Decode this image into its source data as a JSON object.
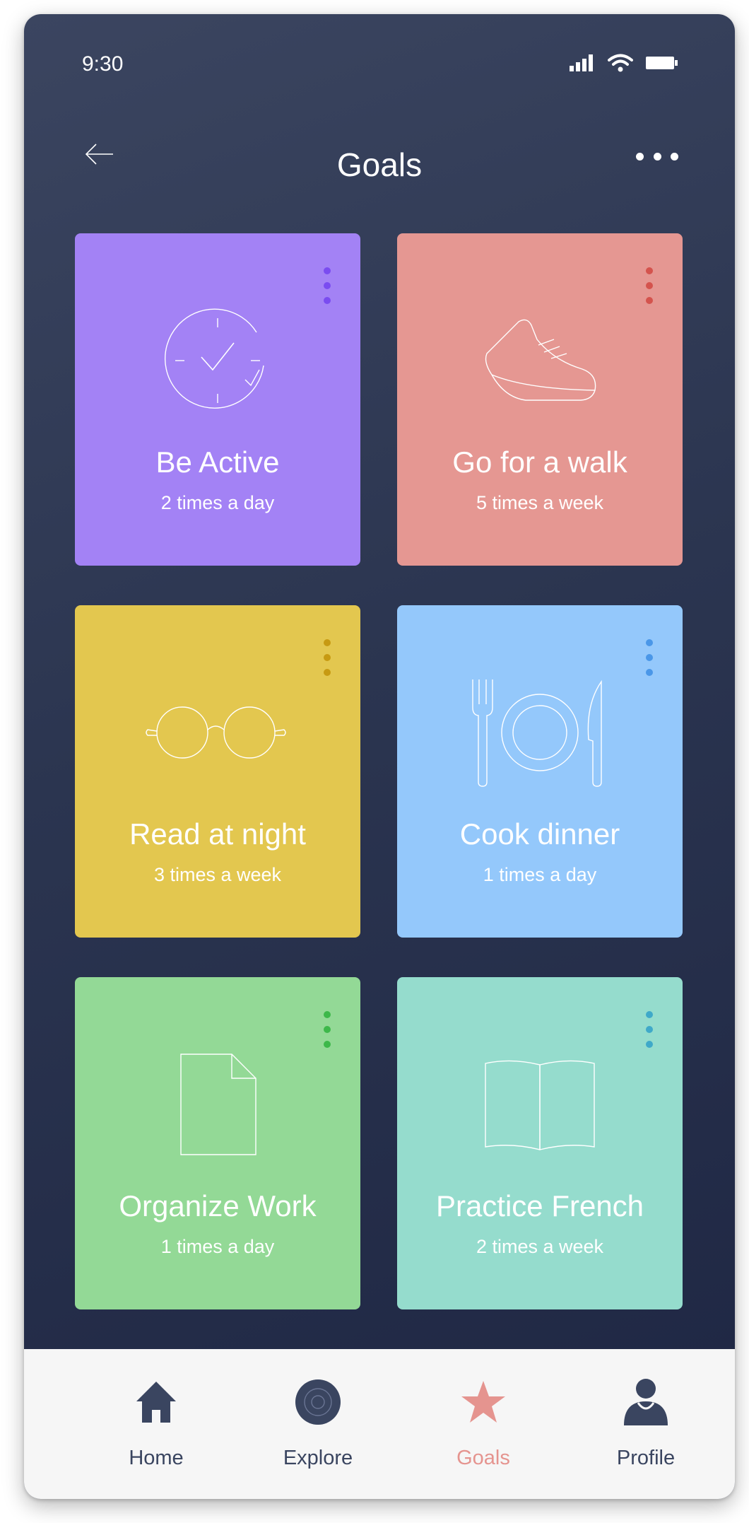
{
  "status_bar": {
    "time": "9:30"
  },
  "header": {
    "title": "Goals"
  },
  "colors": {
    "background_top": "#3b4560",
    "background_bottom": "#1e2643",
    "tab_inactive": "#3a4560",
    "tab_active": "#e5948f"
  },
  "cards": [
    {
      "title": "Be Active",
      "subtitle": "2 times a day",
      "icon": "clock-check-icon",
      "bg": "#a382f5",
      "dot": "#7a4cf0"
    },
    {
      "title": "Go for a walk",
      "subtitle": "5 times a week",
      "icon": "sneaker-icon",
      "bg": "#e59792",
      "dot": "#d4534d"
    },
    {
      "title": "Read at night",
      "subtitle": "3 times a week",
      "icon": "glasses-icon",
      "bg": "#e3c74f",
      "dot": "#c79a12"
    },
    {
      "title": "Cook dinner",
      "subtitle": "1 times a day",
      "icon": "dinner-plate-icon",
      "bg": "#94c8fb",
      "dot": "#4a97e8"
    },
    {
      "title": "Organize Work",
      "subtitle": "1 times a day",
      "icon": "document-icon",
      "bg": "#93d996",
      "dot": "#3db84a"
    },
    {
      "title": "Practice French",
      "subtitle": "2 times a week",
      "icon": "open-book-icon",
      "bg": "#95dccd",
      "dot": "#3fa9c9"
    }
  ],
  "tabs": [
    {
      "label": "Home",
      "icon": "home-icon",
      "active": false
    },
    {
      "label": "Explore",
      "icon": "compass-icon",
      "active": false
    },
    {
      "label": "Goals",
      "icon": "star-icon",
      "active": true
    },
    {
      "label": "Profile",
      "icon": "person-icon",
      "active": false
    }
  ]
}
